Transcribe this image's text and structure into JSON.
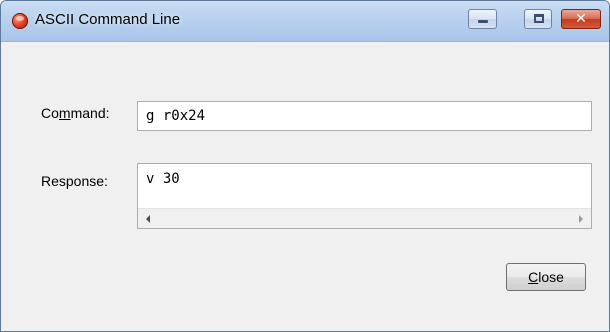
{
  "window": {
    "title": "ASCII Command Line",
    "icon": "app-orb-icon",
    "controls": [
      "minimize-icon",
      "maximize-icon",
      "close-icon"
    ],
    "close_glyph": "✕"
  },
  "form": {
    "command": {
      "label_before": "Co",
      "label_mnemonic": "m",
      "label_after": "mand:",
      "value": "g r0x24"
    },
    "response": {
      "label": "Response:",
      "value": "v 30"
    }
  },
  "buttons": {
    "close": {
      "mnemonic": "C",
      "rest": "lose"
    }
  },
  "colors": {
    "titlebar": "#b8d1ee",
    "close_button": "#c5391c",
    "window_bg": "#f0f0f0"
  }
}
